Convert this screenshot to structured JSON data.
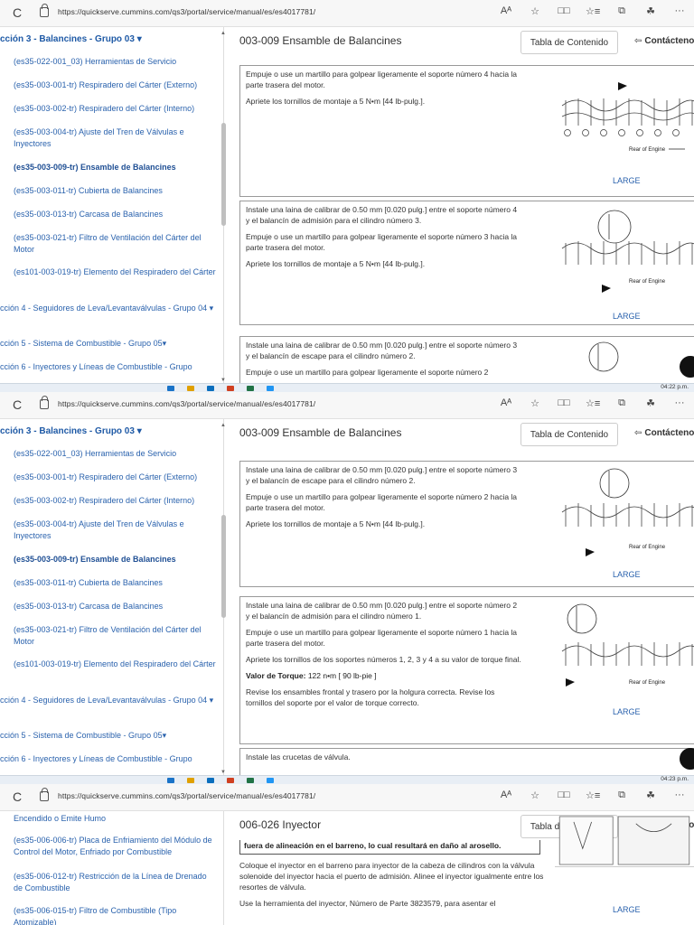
{
  "browser": {
    "url": "https://quickserve.cummins.com/qs3/portal/service/manual/es/es4017781/",
    "reload_icon": "C",
    "tools": [
      "Aᴬ",
      "☆",
      "□□",
      "☆≡",
      "⧉",
      "☘",
      "···"
    ]
  },
  "header": {
    "toc_label": "Tabla de Contenido",
    "contact_label": "Contáctenos"
  },
  "colors": {
    "link": "#2a62ad",
    "border": "#999999"
  },
  "panel1": {
    "section_head": "cción 3 - Balancines - Grupo 03",
    "items": [
      "(es35-022-001_03) Herramientas de Servicio",
      "(es35-003-001-tr) Respiradero del Cárter (Externo)",
      "(es35-003-002-tr) Respiradero del Cárter (Interno)",
      "(es35-003-004-tr) Ajuste del Tren de Válvulas e Inyectores",
      "(es35-003-009-tr) Ensamble de Balancines",
      "(es35-003-011-tr) Cubierta de Balancines",
      "(es35-003-013-tr) Carcasa de Balancines",
      "(es35-003-021-tr) Filtro de Ventilación del Cárter del Motor",
      "(es101-003-019-tr) Elemento del Respiradero del Cárter"
    ],
    "sections": [
      "cción 4 - Seguidores de Leva/Levantaválvulas - Grupo 04",
      "cción 5 - Sistema de Combustible - Grupo 05",
      "cción 6 - Inyectores y Líneas de Combustible - Grupo"
    ],
    "title": "003-009 Ensamble de Balancines",
    "steps": [
      {
        "paras": [
          "Empuje o use un martillo para golpear ligeramente el soporte número 4 hacia la parte trasera del motor.",
          "Apriete los tornillos de montaje a 5 N•m [44 lb-pulg.]."
        ],
        "large": "LARGE",
        "fig_label": "Rear of Engine"
      },
      {
        "paras": [
          "Instale una laina de calibrar de 0.50 mm [0.020 pulg.] entre el soporte número 4 y el balancín de admisión para el cilindro número 3.",
          "Empuje o use un martillo para golpear ligeramente el soporte número 3 hacia la parte trasera del motor.",
          "Apriete los tornillos de montaje a 5 N•m [44 lb-pulg.]."
        ],
        "large": "LARGE",
        "fig_label": "Rear of Engine"
      },
      {
        "paras": [
          "Instale una laina de calibrar de 0.50 mm [0.020 pulg.] entre el soporte número 3 y el balancín de escape para el cilindro número 2.",
          "Empuje o use un martillo para golpear ligeramente el soporte número 2"
        ]
      }
    ],
    "time": "04:22 p.m."
  },
  "panel2": {
    "section_head": "cción 3 - Balancines - Grupo 03",
    "title": "003-009 Ensamble de Balancines",
    "steps": [
      {
        "paras": [
          "Instale una laina de calibrar de 0.50 mm [0.020 pulg.] entre el soporte número 3 y el balancín de escape para el cilindro número 2.",
          "Empuje o use un martillo para golpear ligeramente el soporte número 2 hacia la parte trasera del motor.",
          "Apriete los tornillos de montaje a 5 N•m [44 lb-pulg.]."
        ],
        "large": "LARGE",
        "fig_label": "Rear of Engine"
      },
      {
        "paras": [
          "Instale una laina de calibrar de 0.50 mm [0.020 pulg.] entre el soporte número 2 y el balancín de admisión para el cilindro número 1.",
          "Empuje o use un martillo para golpear ligeramente el soporte número 1 hacia la parte trasera del motor.",
          "Apriete los tornillos de los soportes números 1, 2, 3 y 4 a su valor de torque final."
        ],
        "torque_label": "Valor de Torque:",
        "torque_value": "122  n•m    [ 90 lb-pie ]",
        "after": "Revise los ensambles frontal y trasero por la holgura correcta. Revise los tornillos del soporte por el valor de torque correcto.",
        "large": "LARGE",
        "fig_label": "Rear of Engine"
      },
      {
        "paras": [
          "Instale las crucetas de válvula."
        ]
      }
    ],
    "time": "04:23 p.m."
  },
  "panel3": {
    "items": [
      "Encendido o Emite Humo",
      "(es35-006-006-tr) Placa de Enfriamiento del Módulo de Control del Motor, Enfriado por Combustible",
      "(es35-006-012-tr) Restricción de la Línea de Drenado de Combustible",
      "(es35-006-015-tr) Filtro de Combustible (Tipo Atomizable)"
    ],
    "title": "006-026 Inyector",
    "warning": "fuera de alineación en el barreno, lo cual resultará en daño al arosello.",
    "paras": [
      "Coloque el inyector en el barreno para inyector de la cabeza de cilindros con la válvula solenoide del inyector hacia el puerto de admisión. Alinee el inyector igualmente entre los resortes de válvula.",
      "Use la herramienta del inyector, Número de Parte 3823579, para asentar el"
    ],
    "large": "LARGE"
  }
}
